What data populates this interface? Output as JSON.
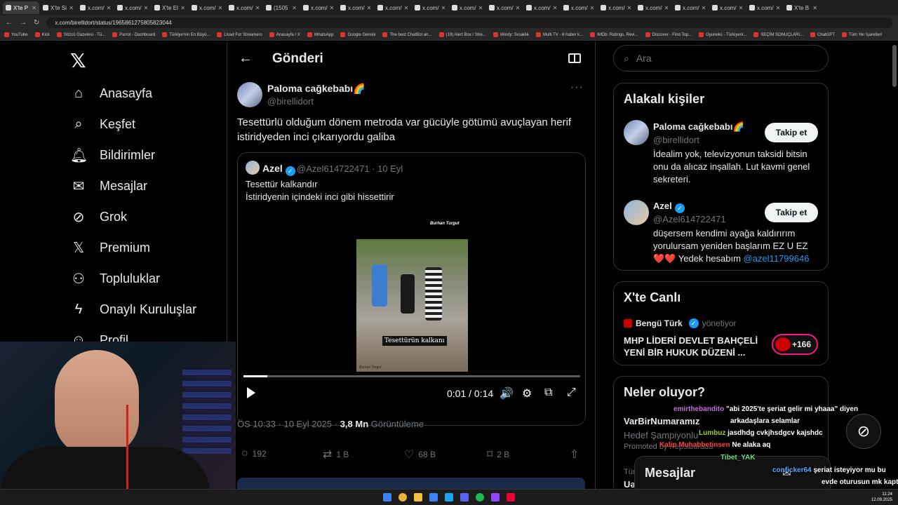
{
  "browser": {
    "tabs": [
      "X'te P",
      "X'te Si",
      "x.com/",
      "x.com/",
      "X'te El",
      "x.com/",
      "x.com/",
      "(1505",
      "x.com/",
      "x.com/",
      "x.com/",
      "x.com/",
      "x.com/",
      "x.com/",
      "x.com/",
      "x.com/",
      "x.com/",
      "x.com/",
      "x.com/",
      "x.com/",
      "x.com/",
      "X'te B"
    ],
    "url": "x.com/birellidort/status/1965861275805823044",
    "bookmarks": [
      "YouTube",
      "Kick",
      "Sözcü Gazetesi - Tü...",
      "Parrot - Dashboard",
      "Türkiye'nin En Büyü...",
      "Livad For Streamers",
      "Anasayfa / X",
      "WhatsApp",
      "Google Gemini",
      "The best ChatBot an...",
      "(19) Alert Box / Stre...",
      "Windy: Sıcaklık",
      "Multi TV - 6 haber k...",
      "IMDb: Ratings, Revi...",
      "Discover - Find Top...",
      "Oyuneks - Türkiyeni...",
      "SEÇİM SONUÇLARI...",
      "ChatGPT",
      "Tüm Yer İşaretleri"
    ]
  },
  "nav": {
    "items": [
      {
        "icon": "home-icon",
        "label": "Anasayfa"
      },
      {
        "icon": "search-icon",
        "label": "Keşfet"
      },
      {
        "icon": "bell-icon",
        "label": "Bildirimler"
      },
      {
        "icon": "mail-icon",
        "label": "Mesajlar"
      },
      {
        "icon": "grok-icon",
        "label": "Grok"
      },
      {
        "icon": "x-icon",
        "label": "Premium"
      },
      {
        "icon": "people-icon",
        "label": "Topluluklar"
      },
      {
        "icon": "bolt-icon",
        "label": "Onaylı Kuruluşlar"
      },
      {
        "icon": "profile-icon",
        "label": "Profil"
      }
    ]
  },
  "header": {
    "title": "Gönderi"
  },
  "post": {
    "name": "Paloma cağkebabı🌈",
    "handle": "@birellidort",
    "text": "Tesettürlü olduğum dönem metroda var gücüyle götümü avuçlayan herif istiridyeden inci çıkarıyordu galiba",
    "timestamp_prefix": "ÖS 10:33 · 10 Eyl 2025 · ",
    "views_value": "3,8 Mn",
    "views_label": " Görüntüleme",
    "actions": {
      "replies": "192",
      "reposts": "1 B",
      "likes": "68 B",
      "bookmarks": "2 B"
    }
  },
  "quote": {
    "name": "Azel",
    "meta": "@Azel614722471 · 10 Eyl",
    "line1": "Tesettür kalkandır",
    "line2": "İstiridyenin içindeki inci gibi hissettirir",
    "video_watermark": "Burhan Turgut",
    "video_caption": "Tesettürün kalkanı",
    "video_signature": "Burhan Turgut",
    "progress": 0.07,
    "time": "0:01 / 0:14"
  },
  "search": {
    "placeholder": "Ara"
  },
  "related": {
    "title": "Alakalı kişiler",
    "follow_label": "Takip et",
    "people": [
      {
        "name": "Paloma cağkebabı🌈",
        "handle": "@birellidort",
        "bio": "İdealim yok, televizyonun taksidi bitsin onu da alıcaz inşallah. Lut kavmi genel sekreteri."
      },
      {
        "name": "Azel",
        "handle": "@Azel614722471",
        "bio": "düşersem kendimi ayağa kaldırırım yorulursam yeniden başlarım EZ U EZ ",
        "bio_hearts": "❤️❤️",
        "bio_tail": " Yedek hesabım ",
        "bio_link": "@azel11799646"
      }
    ]
  },
  "live": {
    "title": "X'te Canlı",
    "host": "Bengü Türk",
    "role": "yönetiyor",
    "headline": "MHP LİDERİ DEVLET BAHÇELİ YENİ BİR HUKUK DÜZENİ ...",
    "badge": "+166"
  },
  "trends": {
    "title": "Neler oluyor?",
    "item1": "VarBirNumaramız",
    "item2": "Hedef Şampiyonlu",
    "promoted": "Promoted by Pepsiburada",
    "item3": "Tür",
    "item4": "Uə"
  },
  "messages": {
    "title": "Mesajlar"
  },
  "chat": [
    {
      "user": "emirthebandito",
      "color": "#c56bd6",
      "msg": "\"abi 2025'te şeriat gelir mi yhaaa\" diyen"
    },
    {
      "user": "",
      "color": "#fff",
      "msg": "arkadaşlara selamlar"
    },
    {
      "user": "Lumbuz",
      "color": "#9acd32",
      "msg": "jasdhdg cvkjhsdgcv kajshdc"
    },
    {
      "user": "Kalip Muhabbetinsen",
      "color": "#ff4040",
      "msg": "Ne alaka aq"
    },
    {
      "user": "Tibet_YAK",
      "color": "#6ee07a",
      "msg": ""
    },
    {
      "user": "conficker64",
      "color": "#5aa9ff",
      "msg": "şeriat isteyiyor mu bu"
    },
    {
      "user": "",
      "color": "#fff",
      "msg": "evde oturusun mk kaptı"
    }
  ],
  "clock": {
    "time": "11:24",
    "date": "12.09.2025"
  }
}
